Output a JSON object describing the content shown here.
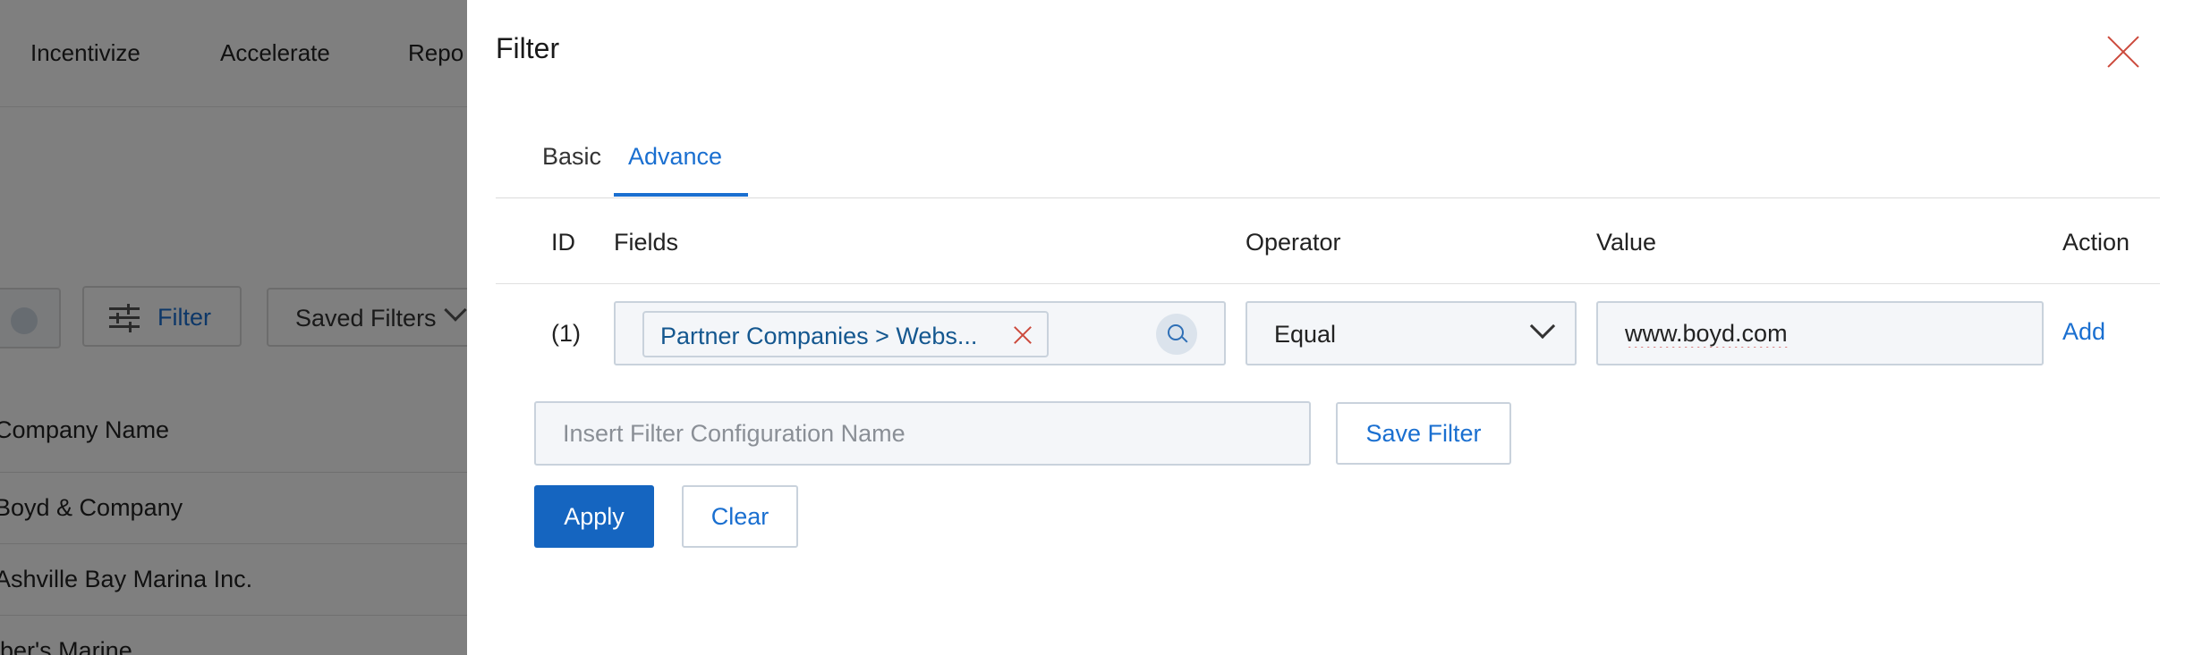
{
  "background": {
    "nav": [
      "Incentivize",
      "Accelerate",
      "Repo"
    ],
    "filter_button_label": "Filter",
    "saved_filters_label": "Saved Filters",
    "column_header": "Company Name",
    "rows": [
      "Boyd & Company",
      "Ashville Bay Marina Inc.",
      "lber's Marine"
    ]
  },
  "panel": {
    "title": "Filter",
    "tabs": [
      {
        "label": "Basic",
        "active": false
      },
      {
        "label": "Advance",
        "active": true
      }
    ],
    "columns": [
      "ID",
      "Fields",
      "Operator",
      "Value",
      "Action"
    ],
    "row": {
      "id": "(1)",
      "field_chip": "Partner Companies > Webs...",
      "operator": "Equal",
      "value": "www.boyd.com",
      "action": "Add"
    },
    "config_placeholder": "Insert Filter Configuration Name",
    "save_filter_label": "Save Filter",
    "apply_label": "Apply",
    "clear_label": "Clear"
  },
  "colors": {
    "accent": "#1a6fd0",
    "primary_button": "#1565c0",
    "close_icon": "#cc4a3c",
    "overlay": "rgba(0,0,0,0.5)"
  }
}
